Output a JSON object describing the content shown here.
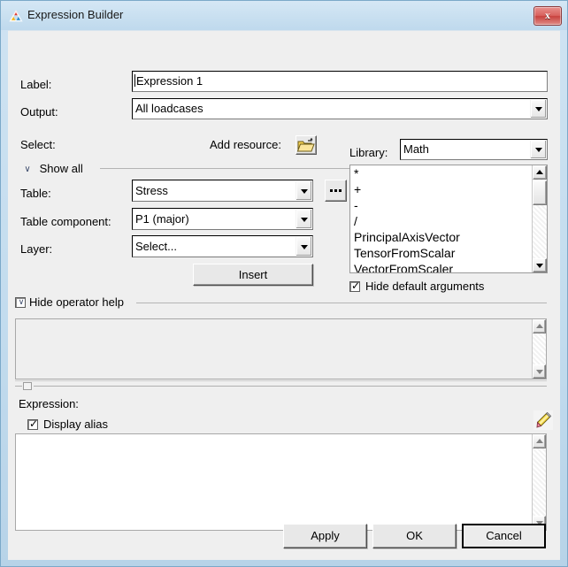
{
  "window": {
    "title": "Expression Builder",
    "icon": "altair-triangle-icon",
    "close_label": "x",
    "frame_color": "#c3dcee"
  },
  "form": {
    "label_caption": "Label:",
    "label_value": "Expression 1",
    "output_caption": "Output:",
    "output_value": "All loadcases"
  },
  "select_group": {
    "caption": "Select:",
    "add_resource_caption": "Add resource:",
    "add_resource_icon": "open-folder-icon",
    "show_all_label": "Show all",
    "table_caption": "Table:",
    "table_value": "Stress",
    "table_browse_label": "...",
    "table_component_caption": "Table component:",
    "table_component_value": "P1 (major)",
    "layer_caption": "Layer:",
    "layer_value": "Select...",
    "insert_label": "Insert"
  },
  "library_group": {
    "caption": "Library:",
    "selected": "Math",
    "items": [
      "*",
      "+",
      "-",
      "/",
      "PrincipalAxisVector",
      "TensorFromScalar",
      "VectorFromScaler"
    ],
    "hide_default_arguments_label": "Hide default arguments",
    "hide_default_arguments_checked": true
  },
  "operator_help": {
    "label": "Hide operator help",
    "checked": true,
    "content": ""
  },
  "expression": {
    "caption": "Expression:",
    "display_alias_label": "Display alias",
    "display_alias_checked": true,
    "edit_icon": "pencil-icon",
    "content": ""
  },
  "footer": {
    "apply_label": "Apply",
    "ok_label": "OK",
    "cancel_label": "Cancel"
  }
}
